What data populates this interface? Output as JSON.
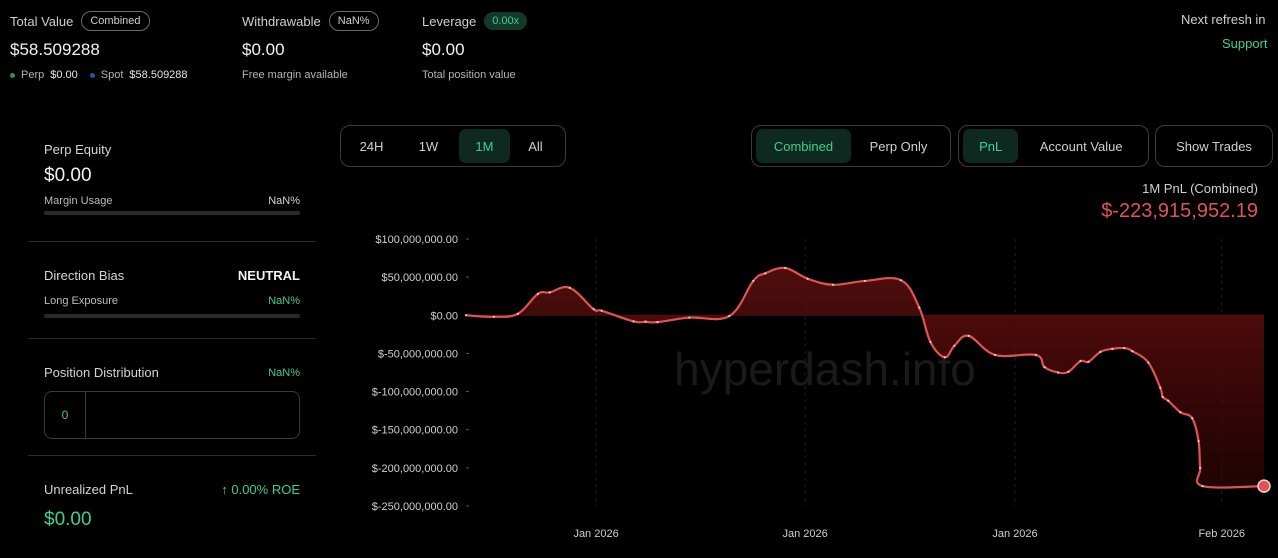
{
  "header": {
    "total_value": {
      "label": "Total Value",
      "tag": "Combined",
      "value": "$58.509288",
      "perp_label": "Perp",
      "perp_value": "$0.00",
      "spot_label": "Spot",
      "spot_value": "$58.509288"
    },
    "withdrawable": {
      "label": "Withdrawable",
      "tag": "NaN%",
      "value": "$0.00",
      "sub": "Free margin available"
    },
    "leverage": {
      "label": "Leverage",
      "tag": "0.00x",
      "value": "$0.00",
      "sub": "Total position value"
    },
    "refresh_text": "Next refresh in",
    "support_text": "Support"
  },
  "left": {
    "perp_equity": {
      "label": "Perp Equity",
      "value": "$0.00",
      "margin_label": "Margin Usage",
      "margin_value": "NaN%"
    },
    "direction": {
      "label": "Direction Bias",
      "value": "NEUTRAL",
      "long_label": "Long Exposure",
      "long_value": "NaN%"
    },
    "distribution": {
      "label": "Position Distribution",
      "value": "NaN%",
      "count": "0"
    },
    "unrealized": {
      "label": "Unrealized PnL",
      "roe": "↑ 0.00% ROE",
      "value": "$0.00"
    }
  },
  "controls": {
    "ranges": [
      "24H",
      "1W",
      "1M",
      "All"
    ],
    "range_active": "1M",
    "modes": [
      "Combined",
      "Perp Only"
    ],
    "mode_active": "Combined",
    "metrics": [
      "PnL",
      "Account Value"
    ],
    "metric_active": "PnL",
    "show_trades": "Show Trades"
  },
  "chart_header": {
    "title": "1M PnL (Combined)",
    "value": "$-223,915,952.19"
  },
  "colors": {
    "accent_green": "#3fce91",
    "line_red": "#e05353",
    "perp_dot": "#2e8b6a",
    "spot_dot": "#2f4fa3"
  },
  "watermark": "hyperdash.info",
  "chart_data": {
    "type": "area",
    "ylim": [
      -250000000,
      100000000
    ],
    "y_ticks": [
      100000000,
      50000000,
      0,
      -50000000,
      -100000000,
      -150000000,
      -200000000,
      -250000000
    ],
    "y_tick_labels": [
      "$100,000,000.00",
      "$50,000,000.00",
      "$0.00",
      "$-50,000,000.00",
      "$-100,000,000.00",
      "$-150,000,000.00",
      "$-200,000,000.00",
      "$-250,000,000.00"
    ],
    "x_tick_labels": [
      "Jan 2026",
      "Jan 2026",
      "Jan 2026",
      "Feb 2026"
    ],
    "x_tick_positions": [
      0.163,
      0.425,
      0.688,
      0.947
    ],
    "grid": true,
    "series": [
      {
        "x": [
          0,
          0.035,
          0.065,
          0.09,
          0.105,
          0.13,
          0.16,
          0.17,
          0.21,
          0.225,
          0.24,
          0.28,
          0.33,
          0.36,
          0.375,
          0.4,
          0.428,
          0.46,
          0.5,
          0.545,
          0.568,
          0.582,
          0.6,
          0.612,
          0.63,
          0.663,
          0.714,
          0.725,
          0.742,
          0.755,
          0.77,
          0.78,
          0.795,
          0.81,
          0.825,
          0.835,
          0.855,
          0.87,
          0.873,
          0.88,
          0.895,
          0.91,
          0.918,
          0.92,
          0.923,
          1.0
        ],
        "y": [
          0,
          -2000000,
          2000000,
          28000000,
          30000000,
          36000000,
          8000000,
          6000000,
          -8000000,
          -8500000,
          -9000000,
          -3000000,
          -1000000,
          45000000,
          55000000,
          62000000,
          48000000,
          40000000,
          45000000,
          46000000,
          10000000,
          -35000000,
          -55000000,
          -40000000,
          -27000000,
          -52000000,
          -52000000,
          -68000000,
          -75000000,
          -74000000,
          -60000000,
          -61000000,
          -48000000,
          -44000000,
          -43000000,
          -47000000,
          -62000000,
          -95000000,
          -107000000,
          -112000000,
          -127000000,
          -135000000,
          -165000000,
          -200000000,
          -223915952,
          -223915952
        ]
      }
    ]
  }
}
